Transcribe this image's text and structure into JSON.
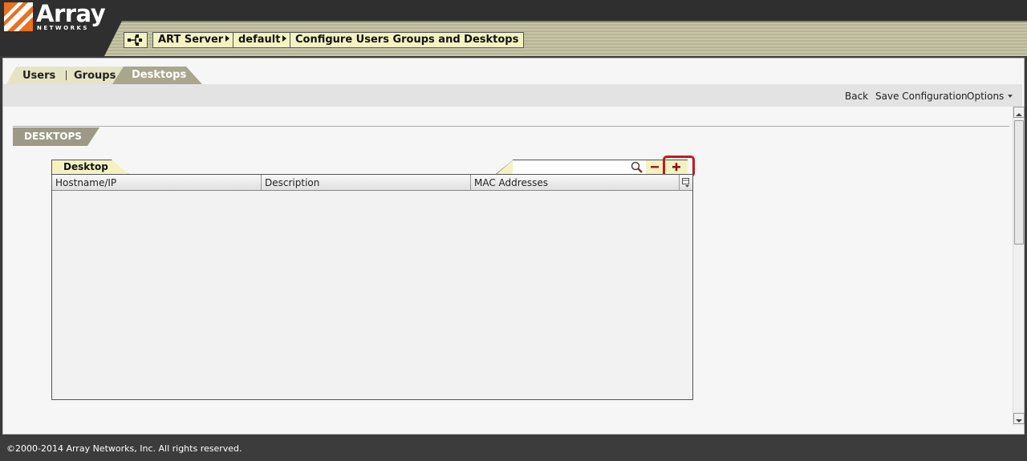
{
  "brand": {
    "name": "Array",
    "sub": "NETWORKS"
  },
  "breadcrumb": {
    "items": [
      {
        "label": "ART Server"
      },
      {
        "label": "default"
      },
      {
        "label": "Configure Users Groups and Desktops"
      }
    ]
  },
  "tabs": [
    {
      "label": "Users",
      "active": false
    },
    {
      "label": "Groups",
      "active": false
    },
    {
      "label": "Desktops",
      "active": true
    }
  ],
  "toolbar": {
    "back": "Back",
    "save": "Save Configuration",
    "options": "Options"
  },
  "section": {
    "title": "DESKTOPS"
  },
  "grid": {
    "tab_label": "Desktop",
    "search_value": "",
    "columns": [
      "Hostname/IP",
      "Description",
      "MAC Addresses"
    ],
    "rows": []
  },
  "icons": {
    "tree": "hierarchy-icon",
    "search": "magnifier-icon",
    "remove": "minus-icon",
    "add": "plus-icon",
    "columns": "column-menu-icon"
  },
  "colors": {
    "header_bg": "#2f2f2f",
    "crumb_bg": "#f4f2c2",
    "tab_active": "#a8a68c",
    "highlight": "#c21a1a",
    "logo_orange": "#e8701e"
  },
  "footer": {
    "copyright": "©2000-2014 Array Networks, Inc. All rights reserved."
  }
}
